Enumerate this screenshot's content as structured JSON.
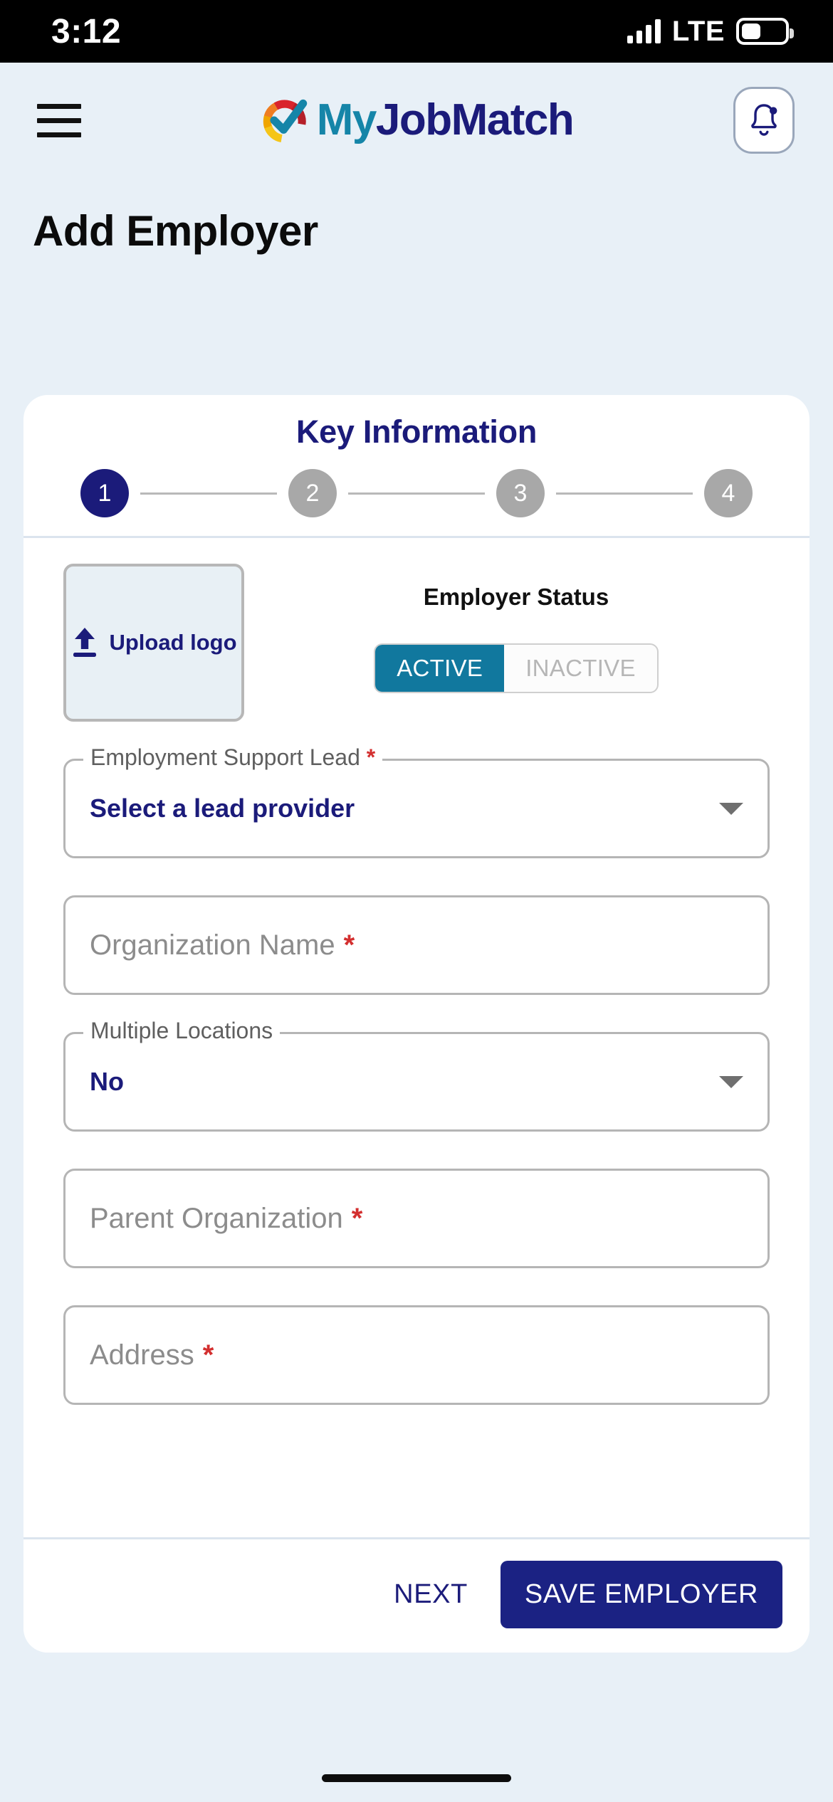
{
  "status_bar": {
    "time": "3:12",
    "network": "LTE",
    "signal_icon": "signal-bars-icon",
    "battery_icon": "battery-icon"
  },
  "header": {
    "menu_icon": "hamburger-menu-icon",
    "logo_icon": "myjobmatch-logo-icon",
    "brand_first": "My",
    "brand_second": "JobMatch",
    "notification_icon": "bell-icon"
  },
  "page": {
    "title": "Add Employer"
  },
  "stepper": {
    "title": "Key Information",
    "steps": [
      {
        "label": "1",
        "state": "active"
      },
      {
        "label": "2",
        "state": "idle"
      },
      {
        "label": "3",
        "state": "idle"
      },
      {
        "label": "4",
        "state": "idle"
      }
    ]
  },
  "upload": {
    "icon": "upload-arrow-icon",
    "label": "Upload logo"
  },
  "employer_status": {
    "title": "Employer Status",
    "active_label": "ACTIVE",
    "inactive_label": "INACTIVE",
    "selected": "ACTIVE"
  },
  "form": {
    "lead": {
      "label": "Employment Support Lead",
      "required": "*",
      "value": "Select a lead provider",
      "caret_icon": "chevron-down-icon"
    },
    "organization_name": {
      "placeholder": "Organization Name",
      "required": "*",
      "value": ""
    },
    "multiple_locations": {
      "label": "Multiple Locations",
      "value": "No",
      "caret_icon": "chevron-down-icon"
    },
    "parent_organization": {
      "placeholder": "Parent Organization",
      "required": "*",
      "value": ""
    },
    "address": {
      "placeholder": "Address",
      "required": "*",
      "value": ""
    }
  },
  "footer": {
    "next_label": "NEXT",
    "save_label": "SAVE EMPLOYER"
  },
  "colors": {
    "navy": "#1b1b7a",
    "teal": "#11789e",
    "page_bg": "#e8f0f7",
    "required_red": "#d32f2f",
    "save_button": "#1b2283"
  }
}
